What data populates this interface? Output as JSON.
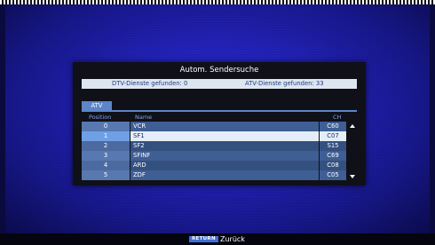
{
  "dialog": {
    "title": "Autom. Sendersuche",
    "dtv_found": "DTV-Dienste gefunden: 0",
    "atv_found": "ATV-Dienste gefunden: 33"
  },
  "tab": {
    "label": "ATV"
  },
  "columns": {
    "position": "Position",
    "name": "Name",
    "channel": "CH"
  },
  "rows": [
    {
      "position": "0",
      "name": "VCR",
      "channel": "C60"
    },
    {
      "position": "1",
      "name": "SF1",
      "channel": "C07"
    },
    {
      "position": "2",
      "name": "SF2",
      "channel": "S15"
    },
    {
      "position": "3",
      "name": "SFINF",
      "channel": "C69"
    },
    {
      "position": "4",
      "name": "ARD",
      "channel": "C08"
    },
    {
      "position": "5",
      "name": "ZDF",
      "channel": "C05"
    }
  ],
  "selected_row": 1,
  "footer": {
    "return_key": "RETURN",
    "return_label": "Zurück"
  },
  "icons": {
    "scroll_up": "triangle-up",
    "scroll_down": "triangle-down"
  },
  "colors": {
    "background": "#2222b8",
    "dialog": "#101018",
    "accent": "#5d86c8",
    "selected": "#e4eef8",
    "return_key": "#3f6fd8"
  }
}
